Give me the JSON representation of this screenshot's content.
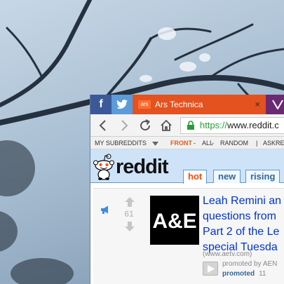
{
  "tabs": {
    "facebook": "f",
    "ars_favicon": "ars",
    "ars_title": "Ars Technica",
    "close": "×"
  },
  "address_bar": {
    "scheme": "https://",
    "host": "www.reddit.c"
  },
  "subreddit_bar": {
    "my_subreddits": "MY SUBREDDITS",
    "front": "FRONT",
    "sep1": " - ",
    "all": "ALL",
    "sep2": " - ",
    "random": "RANDOM",
    "divider": "|",
    "askreddit": "ASKRED"
  },
  "header": {
    "logo": "reddit",
    "tabs": [
      "hot",
      "new",
      "rising"
    ],
    "active_tab": "hot"
  },
  "post": {
    "score": "61",
    "title_lines": [
      "Leah Remini an",
      "questions from",
      "Part 2 of the Le",
      "special Tuesda"
    ],
    "domain": "(www.aetv.com)",
    "promoted_by": "promoted by AEN",
    "promoted_label": "promoted",
    "count": "11"
  },
  "colors": {
    "ars_tab": "#e3521f",
    "facebook": "#3b5998",
    "twitter": "#5b9bd8",
    "reddit_header": "#cee3f8",
    "reddit_orangered": "#ff4500",
    "link_blue": "#0033cc"
  },
  "icons": [
    "facebook-icon",
    "twitter-icon",
    "ars-favicon",
    "close-icon",
    "vivaldi-icon",
    "back-icon",
    "forward-icon",
    "reload-icon",
    "home-icon",
    "lock-icon",
    "dropdown-arrow-icon",
    "reddit-alien-icon",
    "megaphone-icon",
    "upvote-icon",
    "downvote-icon",
    "play-icon"
  ]
}
